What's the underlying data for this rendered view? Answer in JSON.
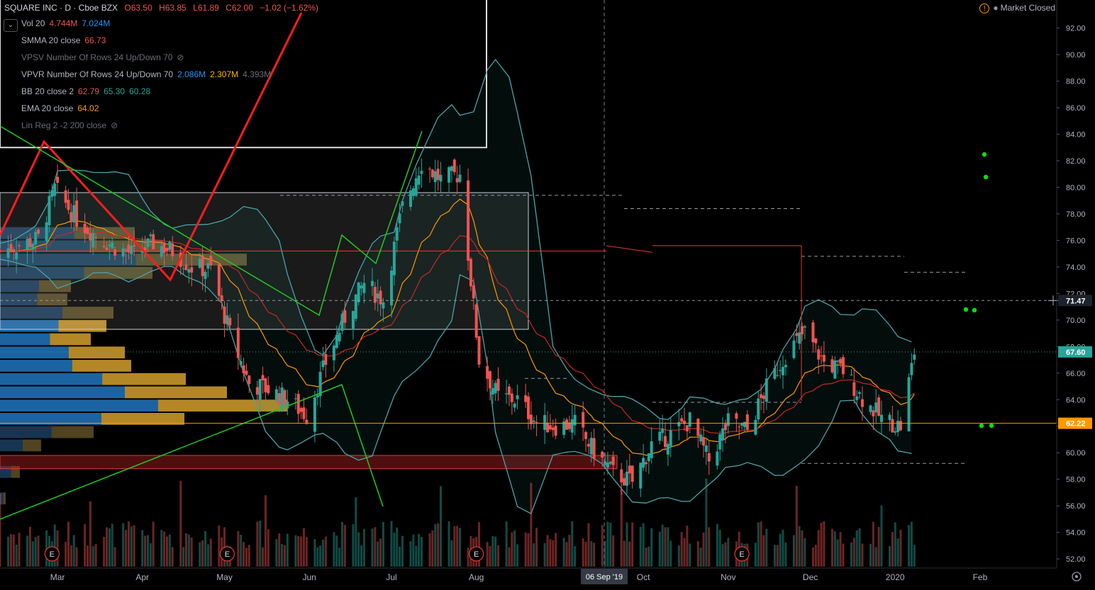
{
  "header": {
    "symbol": "SQUARE INC · D · Cboe BZX",
    "open": "O63.50",
    "high": "H63.85",
    "low": "L61.89",
    "close": "C62.00",
    "change": "−1.02 (−1.62%)"
  },
  "indicators": [
    {
      "name": "Vol 20",
      "values": [
        "4.744M",
        "7.024M"
      ],
      "colors": [
        "#ef5350",
        "#2196f3"
      ],
      "visible": true
    },
    {
      "name": "SMMA 20 close",
      "values": [
        "66.73"
      ],
      "colors": [
        "#ef5350"
      ],
      "visible": true
    },
    {
      "name": "VPSV Number Of Rows 24 Up/Down 70",
      "values": [],
      "colors": [],
      "visible": false
    },
    {
      "name": "VPVR Number Of Rows 24 Up/Down 70",
      "values": [
        "2.086M",
        "2.307M",
        "4.393M"
      ],
      "colors": [
        "#2196f3",
        "#ffb300",
        "#6a6d78"
      ],
      "visible": true
    },
    {
      "name": "BB 20 close 2",
      "values": [
        "62.79",
        "65.30",
        "60.28"
      ],
      "colors": [
        "#ef5350",
        "#26a69a",
        "#26a69a"
      ],
      "visible": true
    },
    {
      "name": "EMA 20 close",
      "values": [
        "64.02"
      ],
      "colors": [
        "#ff9800"
      ],
      "visible": true
    },
    {
      "name": "Lin Reg 2 -2 200 close",
      "values": [],
      "colors": [],
      "visible": false
    }
  ],
  "status": {
    "warning_icon": "!",
    "market": "Market Closed"
  },
  "crosshair_date": "06 Sep '19",
  "price_badges": [
    {
      "value": 71.47,
      "label": "71.47",
      "bg": "#1e222d",
      "fg": "#ffffff"
    },
    {
      "value": 67.6,
      "label": "67.60",
      "bg": "#26a69a",
      "fg": "#ffffff"
    },
    {
      "value": 62.22,
      "label": "62.22",
      "bg": "#ff9800",
      "fg": "#ffffff"
    }
  ],
  "earnings_marker": "E",
  "chart_data": {
    "type": "candlestick",
    "title": "SQUARE INC · D · Cboe BZX",
    "interval": "D",
    "ylim": [
      50.8,
      93.4
    ],
    "yticks": [
      52,
      54,
      56,
      58,
      60,
      62,
      64,
      66,
      68,
      70,
      72,
      74,
      76,
      78,
      80,
      82,
      84,
      86,
      88,
      90,
      92
    ],
    "ytick_labels": [
      "52.00",
      "54.00",
      "56.00",
      "58.00",
      "60.00",
      "62.00",
      "64.00",
      "66.00",
      "68.00",
      "70.00",
      "72.00",
      "74.00",
      "76.00",
      "78.00",
      "80.00",
      "82.00",
      "84.00",
      "86.00",
      "88.00",
      "90.00",
      "92.00"
    ],
    "x_axis_labels": [
      "Mar",
      "Apr",
      "May",
      "Jun",
      "Jul",
      "Aug",
      "Oct",
      "Nov",
      "Dec",
      "2020",
      "Feb"
    ],
    "x_axis_dates": [
      "2019-03-01",
      "2019-04-01",
      "2019-05-01",
      "2019-06-01",
      "2019-07-01",
      "2019-08-01",
      "2019-10-01",
      "2019-11-01",
      "2019-12-01",
      "2020-01-01",
      "2020-02-01"
    ],
    "x_range": [
      "2019-02-08",
      "2020-02-29"
    ],
    "earnings_dates": [
      "2019-02-27",
      "2019-05-02",
      "2019-08-01",
      "2019-11-06"
    ],
    "closes": [
      {
        "date": "2019-02-08",
        "close": 75.2
      },
      {
        "date": "2019-02-22",
        "close": 76.1
      },
      {
        "date": "2019-02-28",
        "close": 79.9
      },
      {
        "date": "2019-03-08",
        "close": 77.6
      },
      {
        "date": "2019-03-15",
        "close": 76.4
      },
      {
        "date": "2019-03-22",
        "close": 75.5
      },
      {
        "date": "2019-03-29",
        "close": 74.9
      },
      {
        "date": "2019-04-05",
        "close": 75.8
      },
      {
        "date": "2019-04-12",
        "close": 75.2
      },
      {
        "date": "2019-04-19",
        "close": 74.0
      },
      {
        "date": "2019-04-26",
        "close": 73.8
      },
      {
        "date": "2019-05-03",
        "close": 69.0
      },
      {
        "date": "2019-05-10",
        "close": 65.2
      },
      {
        "date": "2019-05-17",
        "close": 64.8
      },
      {
        "date": "2019-05-24",
        "close": 64.0
      },
      {
        "date": "2019-05-31",
        "close": 62.8
      },
      {
        "date": "2019-06-07",
        "close": 66.8
      },
      {
        "date": "2019-06-14",
        "close": 70.2
      },
      {
        "date": "2019-06-21",
        "close": 72.8
      },
      {
        "date": "2019-06-28",
        "close": 71.5
      },
      {
        "date": "2019-07-05",
        "close": 78.5
      },
      {
        "date": "2019-07-12",
        "close": 81.9
      },
      {
        "date": "2019-07-19",
        "close": 80.6
      },
      {
        "date": "2019-07-26",
        "close": 81.0
      },
      {
        "date": "2019-08-02",
        "close": 67.0
      },
      {
        "date": "2019-08-09",
        "close": 64.2
      },
      {
        "date": "2019-08-16",
        "close": 64.0
      },
      {
        "date": "2019-08-23",
        "close": 62.3
      },
      {
        "date": "2019-08-30",
        "close": 62.0
      },
      {
        "date": "2019-09-06",
        "close": 62.2
      },
      {
        "date": "2019-09-13",
        "close": 60.1
      },
      {
        "date": "2019-09-20",
        "close": 58.5
      },
      {
        "date": "2019-09-27",
        "close": 57.8
      },
      {
        "date": "2019-10-04",
        "close": 60.6
      },
      {
        "date": "2019-10-11",
        "close": 61.4
      },
      {
        "date": "2019-10-18",
        "close": 62.4
      },
      {
        "date": "2019-10-25",
        "close": 59.4
      },
      {
        "date": "2019-11-01",
        "close": 62.3
      },
      {
        "date": "2019-11-08",
        "close": 61.7
      },
      {
        "date": "2019-11-15",
        "close": 64.9
      },
      {
        "date": "2019-11-22",
        "close": 67.4
      },
      {
        "date": "2019-11-29",
        "close": 69.1
      },
      {
        "date": "2019-12-06",
        "close": 66.8
      },
      {
        "date": "2019-12-13",
        "close": 66.2
      },
      {
        "date": "2019-12-20",
        "close": 64.1
      },
      {
        "date": "2019-12-27",
        "close": 62.6
      },
      {
        "date": "2020-01-03",
        "close": 62.0
      },
      {
        "date": "2020-01-08",
        "close": 67.6
      }
    ],
    "last_close": 62.0,
    "last_price": 67.6,
    "horizontal_levels": [
      {
        "value": 71.47,
        "style": "dashed",
        "color": "#9598a1"
      },
      {
        "value": 62.22,
        "style": "solid",
        "color": "#ff9800"
      }
    ],
    "grid": false
  }
}
